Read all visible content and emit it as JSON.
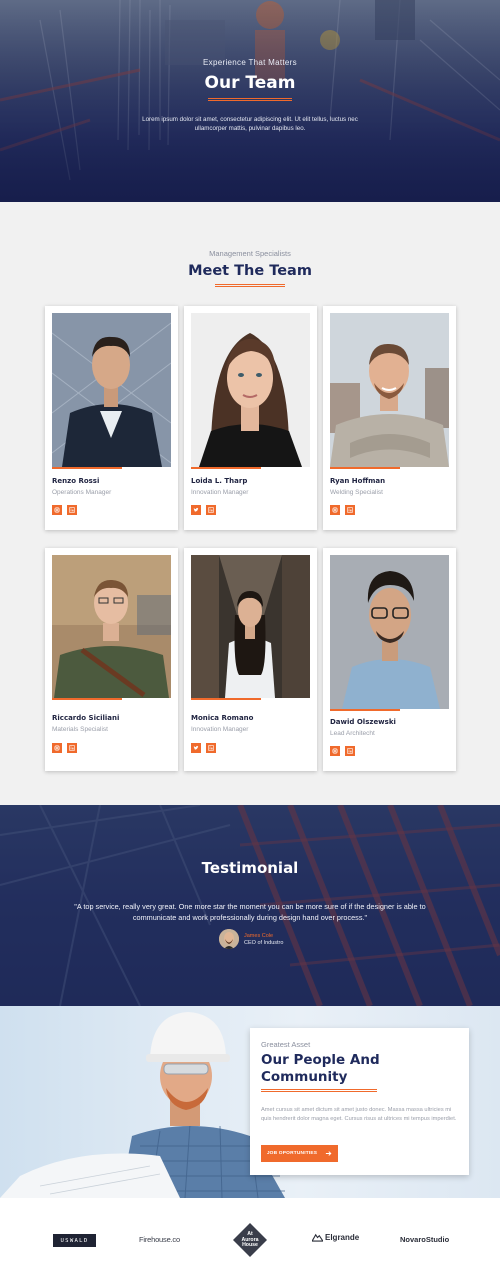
{
  "hero": {
    "eyebrow": "Experience That Matters",
    "title": "Our Team",
    "text": "Lorem ipsum dolor sit amet, consectetur adipiscing elit. Ut elit tellus, luctus nec ullamcorper mattis, pulvinar dapibus leo."
  },
  "team": {
    "eyebrow": "Management Specialists",
    "title": "Meet The Team",
    "members": [
      {
        "name": "Renzo Rossi",
        "role": "Operations Manager",
        "socials": [
          "instagram-icon",
          "linkedin-icon"
        ]
      },
      {
        "name": "Loida L. Tharp",
        "role": "Innovation Manager",
        "socials": [
          "twitter-icon",
          "linkedin-icon"
        ]
      },
      {
        "name": "Ryan Hoffman",
        "role": "Welding Specialist",
        "socials": [
          "instagram-icon",
          "linkedin-icon"
        ]
      },
      {
        "name": "Riccardo Siciliani",
        "role": "Materials Specialist",
        "socials": [
          "instagram-icon",
          "linkedin-icon"
        ]
      },
      {
        "name": "Monica Romano",
        "role": "Innovation Manager",
        "socials": [
          "twitter-icon",
          "linkedin-icon"
        ]
      },
      {
        "name": "Dawid Olszewski",
        "role": "Lead Architecht",
        "socials": [
          "instagram-icon",
          "linkedin-icon"
        ]
      }
    ]
  },
  "testimonial": {
    "title": "Testimonial",
    "quote": "\"A top service, really very great. One more star the moment you can be more sure of if the designer is able to communicate and work professionally during design hand over process.\"",
    "author_name": "James Cole",
    "author_role": "CEO of Industro"
  },
  "people": {
    "eyebrow": "Greatest Asset",
    "title": "Our People And Community",
    "text": "Amet cursus sit amet dictum sit amet justo donec. Massa massa ultricies mi quis hendrerit dolor magna eget. Cursus risus at ultrices mi tempus imperdiet.",
    "button_label": "JOB OPORTUNITIES"
  },
  "logos": [
    "USWALD",
    "Firehouse.co",
    "At Aurora House",
    "Elgrande",
    "NovaroStudio"
  ],
  "colors": {
    "accent": "#f06a2c",
    "navy": "#1f2a5c"
  }
}
